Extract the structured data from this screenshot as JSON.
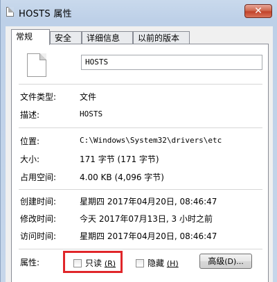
{
  "window": {
    "title": "HOSTS 属性",
    "close_label": "✕"
  },
  "tabs": [
    {
      "label": "常规",
      "active": true
    },
    {
      "label": "安全",
      "active": false
    },
    {
      "label": "详细信息",
      "active": false
    },
    {
      "label": "以前的版本",
      "active": false
    }
  ],
  "file": {
    "icon": "file-icon",
    "name": "HOSTS"
  },
  "type_section": {
    "file_type_label": "文件类型:",
    "file_type_value": "文件",
    "description_label": "描述:",
    "description_value": "HOSTS"
  },
  "location_section": {
    "location_label": "位置:",
    "location_value": "C:\\Windows\\System32\\drivers\\etc",
    "size_label": "大小:",
    "size_value": "171 字节 (171 字节)",
    "disk_size_label": "占用空间:",
    "disk_size_value": "4.00 KB (4,096 字节)"
  },
  "time_section": {
    "created_label": "创建时间:",
    "created_value": "星期四 2017年04月20日, 08:46:47",
    "modified_label": "修改时间:",
    "modified_value": "今天 2017年07月13日, 3 小时之前",
    "accessed_label": "访问时间:",
    "accessed_value": "星期四 2017年04月20日, 08:46:47"
  },
  "attributes": {
    "label": "属性:",
    "readonly_label": "只读",
    "readonly_key": "(R)",
    "readonly_checked": false,
    "hidden_label": "隐藏",
    "hidden_key": "(H)",
    "hidden_checked": false,
    "advanced_label": "高级",
    "advanced_key": "(D)...",
    "highlight_color": "#e0262a"
  }
}
